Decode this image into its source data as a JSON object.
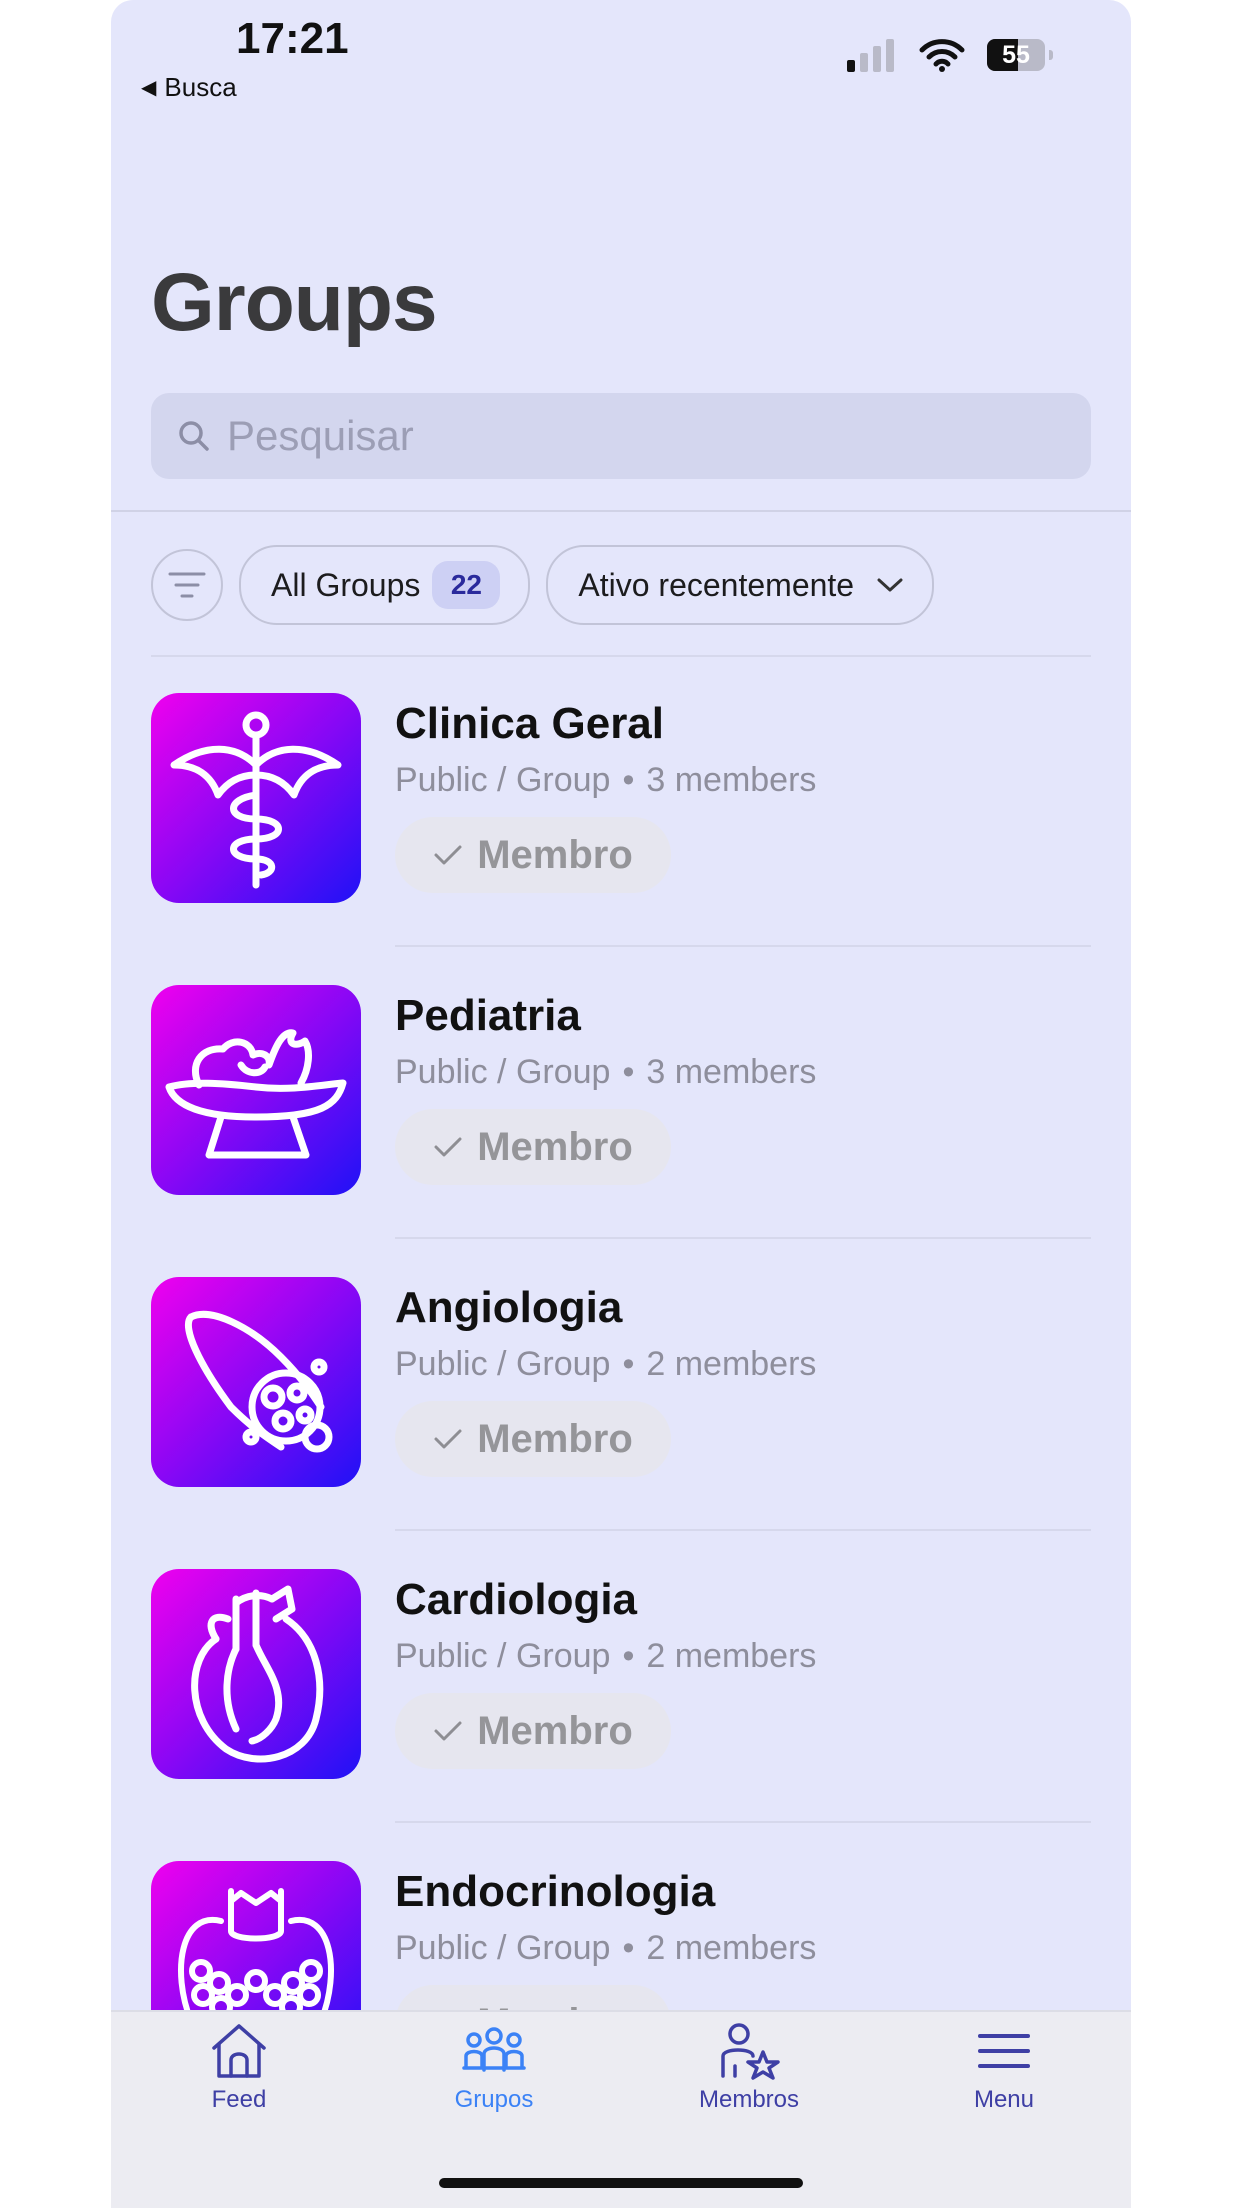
{
  "status_bar": {
    "time": "17:21",
    "back_label": "Busca",
    "battery": "55"
  },
  "page": {
    "title": "Groups"
  },
  "search": {
    "placeholder": "Pesquisar"
  },
  "filters": {
    "all_groups_label": "All Groups",
    "all_groups_count": "22",
    "sort_label": "Ativo recentemente"
  },
  "groups": [
    {
      "name": "Clinica Geral",
      "type": "Public / Group",
      "members": "3 members",
      "button": "Membro",
      "icon": "caduceus-icon"
    },
    {
      "name": "Pediatria",
      "type": "Public / Group",
      "members": "3 members",
      "button": "Membro",
      "icon": "baby-scale-icon"
    },
    {
      "name": "Angiologia",
      "type": "Public / Group",
      "members": "2 members",
      "button": "Membro",
      "icon": "blood-vessel-icon"
    },
    {
      "name": "Cardiologia",
      "type": "Public / Group",
      "members": "2 members",
      "button": "Membro",
      "icon": "heart-icon"
    },
    {
      "name": "Endocrinologia",
      "type": "Public / Group",
      "members": "2 members",
      "button": "Membro",
      "icon": "thyroid-icon"
    }
  ],
  "tabs": [
    {
      "label": "Feed",
      "icon": "home-icon",
      "active": false
    },
    {
      "label": "Grupos",
      "icon": "groups-icon",
      "active": true
    },
    {
      "label": "Membros",
      "icon": "member-star-icon",
      "active": false
    },
    {
      "label": "Menu",
      "icon": "hamburger-icon",
      "active": false
    }
  ],
  "colors": {
    "background": "#e4e6fb",
    "accent": "#3b82f6",
    "tab_inactive": "#3e3fa5",
    "avatar_gradient_start": "#f000ee",
    "avatar_gradient_end": "#1f12f6"
  }
}
